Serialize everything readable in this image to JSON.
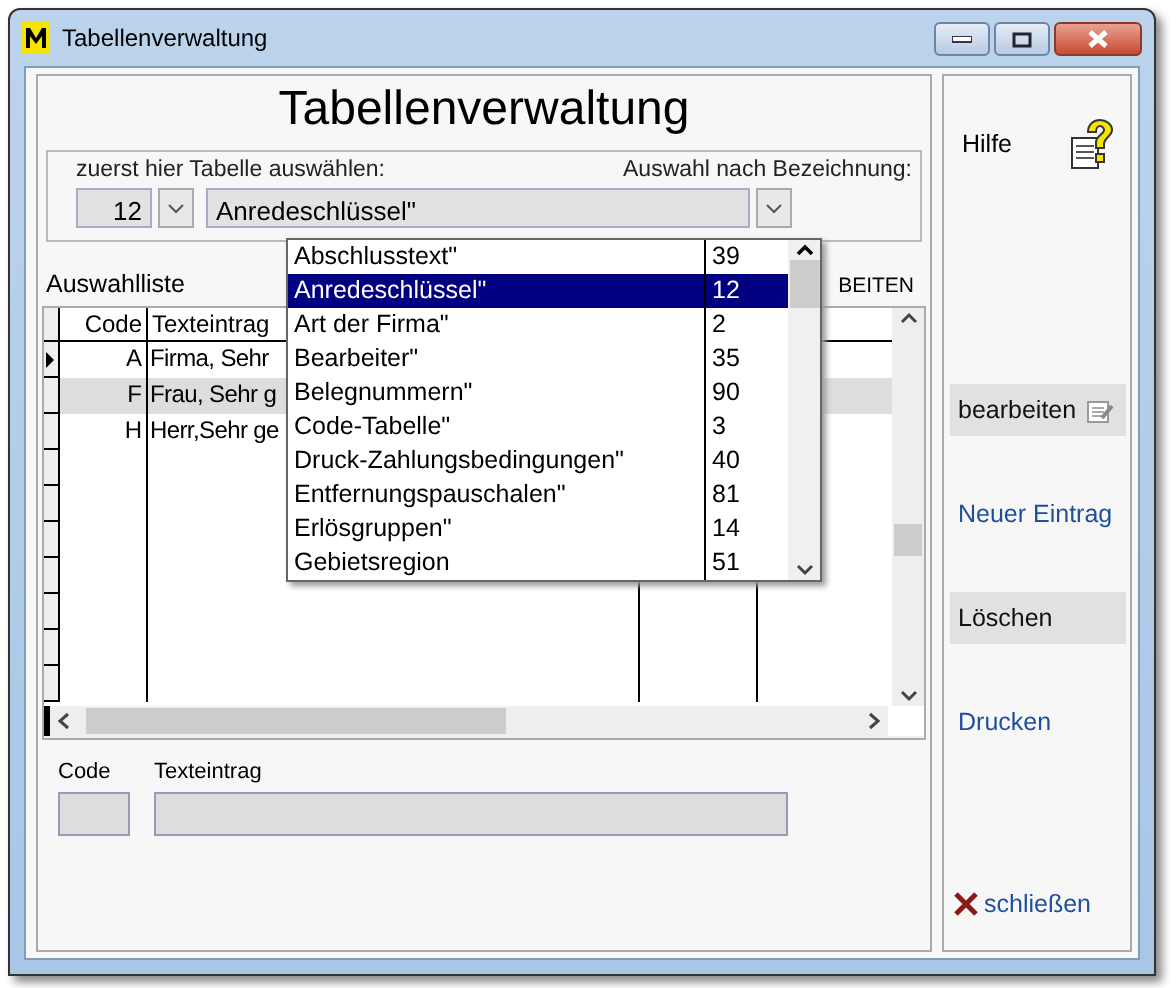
{
  "window": {
    "title": "Tabellenverwaltung"
  },
  "heading": "Tabellenverwaltung",
  "selector": {
    "label": "zuerst hier Tabelle auswählen:",
    "number": "12",
    "value": "Anredeschlüssel\"",
    "by_name_label": "Auswahl nach Bezeichnung:"
  },
  "dropdown": {
    "items": [
      {
        "name": "Abschlusstext\"",
        "number": "39",
        "selected": false
      },
      {
        "name": "Anredeschlüssel\"",
        "number": "12",
        "selected": true
      },
      {
        "name": "Art der Firma\"",
        "number": "2",
        "selected": false
      },
      {
        "name": "Bearbeiter\"",
        "number": "35",
        "selected": false
      },
      {
        "name": "Belegnummern\"",
        "number": "90",
        "selected": false
      },
      {
        "name": "Code-Tabelle\"",
        "number": "3",
        "selected": false
      },
      {
        "name": "Druck-Zahlungsbedingungen\"",
        "number": "40",
        "selected": false
      },
      {
        "name": "Entfernungspauschalen\"",
        "number": "81",
        "selected": false
      },
      {
        "name": "Erlösgruppen\"",
        "number": "14",
        "selected": false
      },
      {
        "name": "Gebietsregion",
        "number": "51",
        "selected": false
      }
    ]
  },
  "list": {
    "label": "Auswahlliste",
    "action_label": "BEITEN",
    "columns": [
      "Code",
      "Texteintrag"
    ],
    "rows": [
      {
        "code": "A",
        "text": "Firma, Sehr",
        "selected": false,
        "current": true
      },
      {
        "code": "F",
        "text": "Frau, Sehr g",
        "selected": true,
        "current": false
      },
      {
        "code": "H",
        "text": "Herr,Sehr ge",
        "selected": false,
        "current": false
      }
    ]
  },
  "form": {
    "code_label": "Code",
    "text_label": "Texteintrag"
  },
  "sidebar": {
    "help": "Hilfe",
    "buttons": [
      {
        "label": "bearbeiten",
        "kind": "flat",
        "icon": true
      },
      {
        "label": "Neuer Eintrag",
        "kind": "link",
        "icon": false
      },
      {
        "label": "Löschen",
        "kind": "flat",
        "icon": false
      },
      {
        "label": "Drucken",
        "kind": "link",
        "icon": false
      }
    ],
    "close": "schließen"
  }
}
